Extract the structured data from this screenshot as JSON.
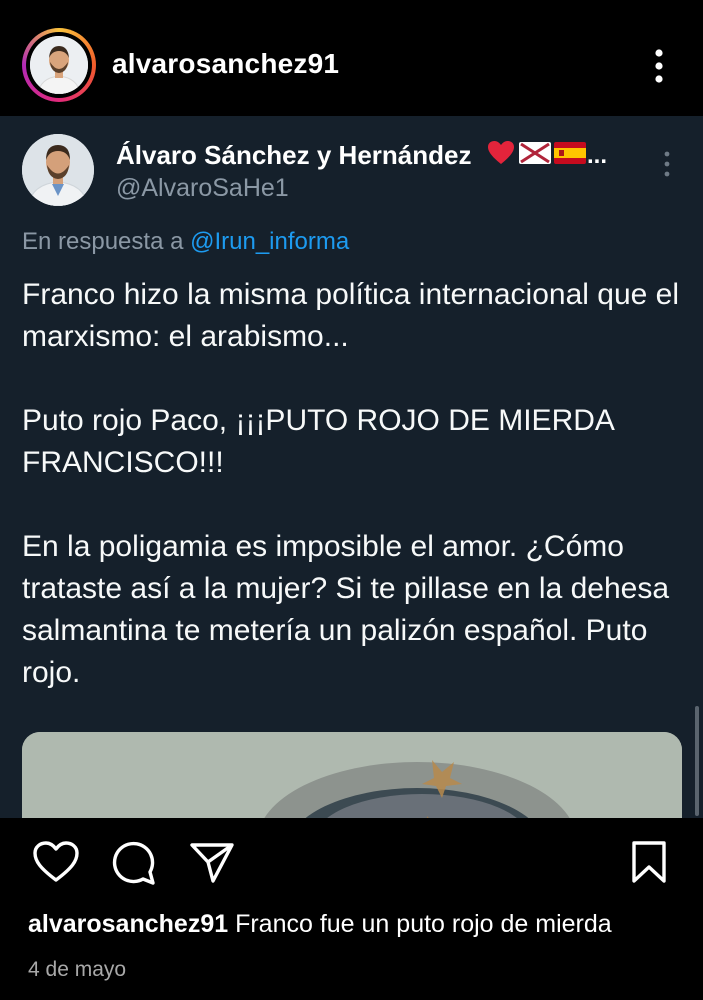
{
  "header": {
    "username": "alvarosanchez91",
    "more_icon": "vertical-dots-icon"
  },
  "tweet": {
    "display_name": "Álvaro Sánchez y Hernández",
    "name_emojis": [
      "red-heart",
      "burgundy-cross-flag",
      "spain-flag"
    ],
    "name_ellipsis": "...",
    "handle": "@AlvaroSaHe1",
    "reply_prefix": "En respuesta a",
    "reply_mention": "@Irun_informa",
    "paragraphs": [
      "Franco hizo la misma política internacional que el marxismo: el arabismo...",
      "Puto rojo Paco, ¡¡¡PUTO ROJO DE MIERDA FRANCISCO!!!",
      "En la poligamia es imposible el amor. ¿Cómo trataste así a la mujer? Si te pillase en la dehesa salmantina te metería un palizón español. Puto rojo."
    ],
    "colors": {
      "background": "#15202b",
      "link": "#1d9bf0",
      "secondary_text": "#8b98a5"
    }
  },
  "footer": {
    "actions": [
      "heart-icon",
      "comment-icon",
      "share-icon",
      "bookmark-icon"
    ],
    "caption_user": "alvarosanchez91",
    "caption_text": "Franco fue un puto rojo de mierda",
    "date": "4 de mayo"
  }
}
